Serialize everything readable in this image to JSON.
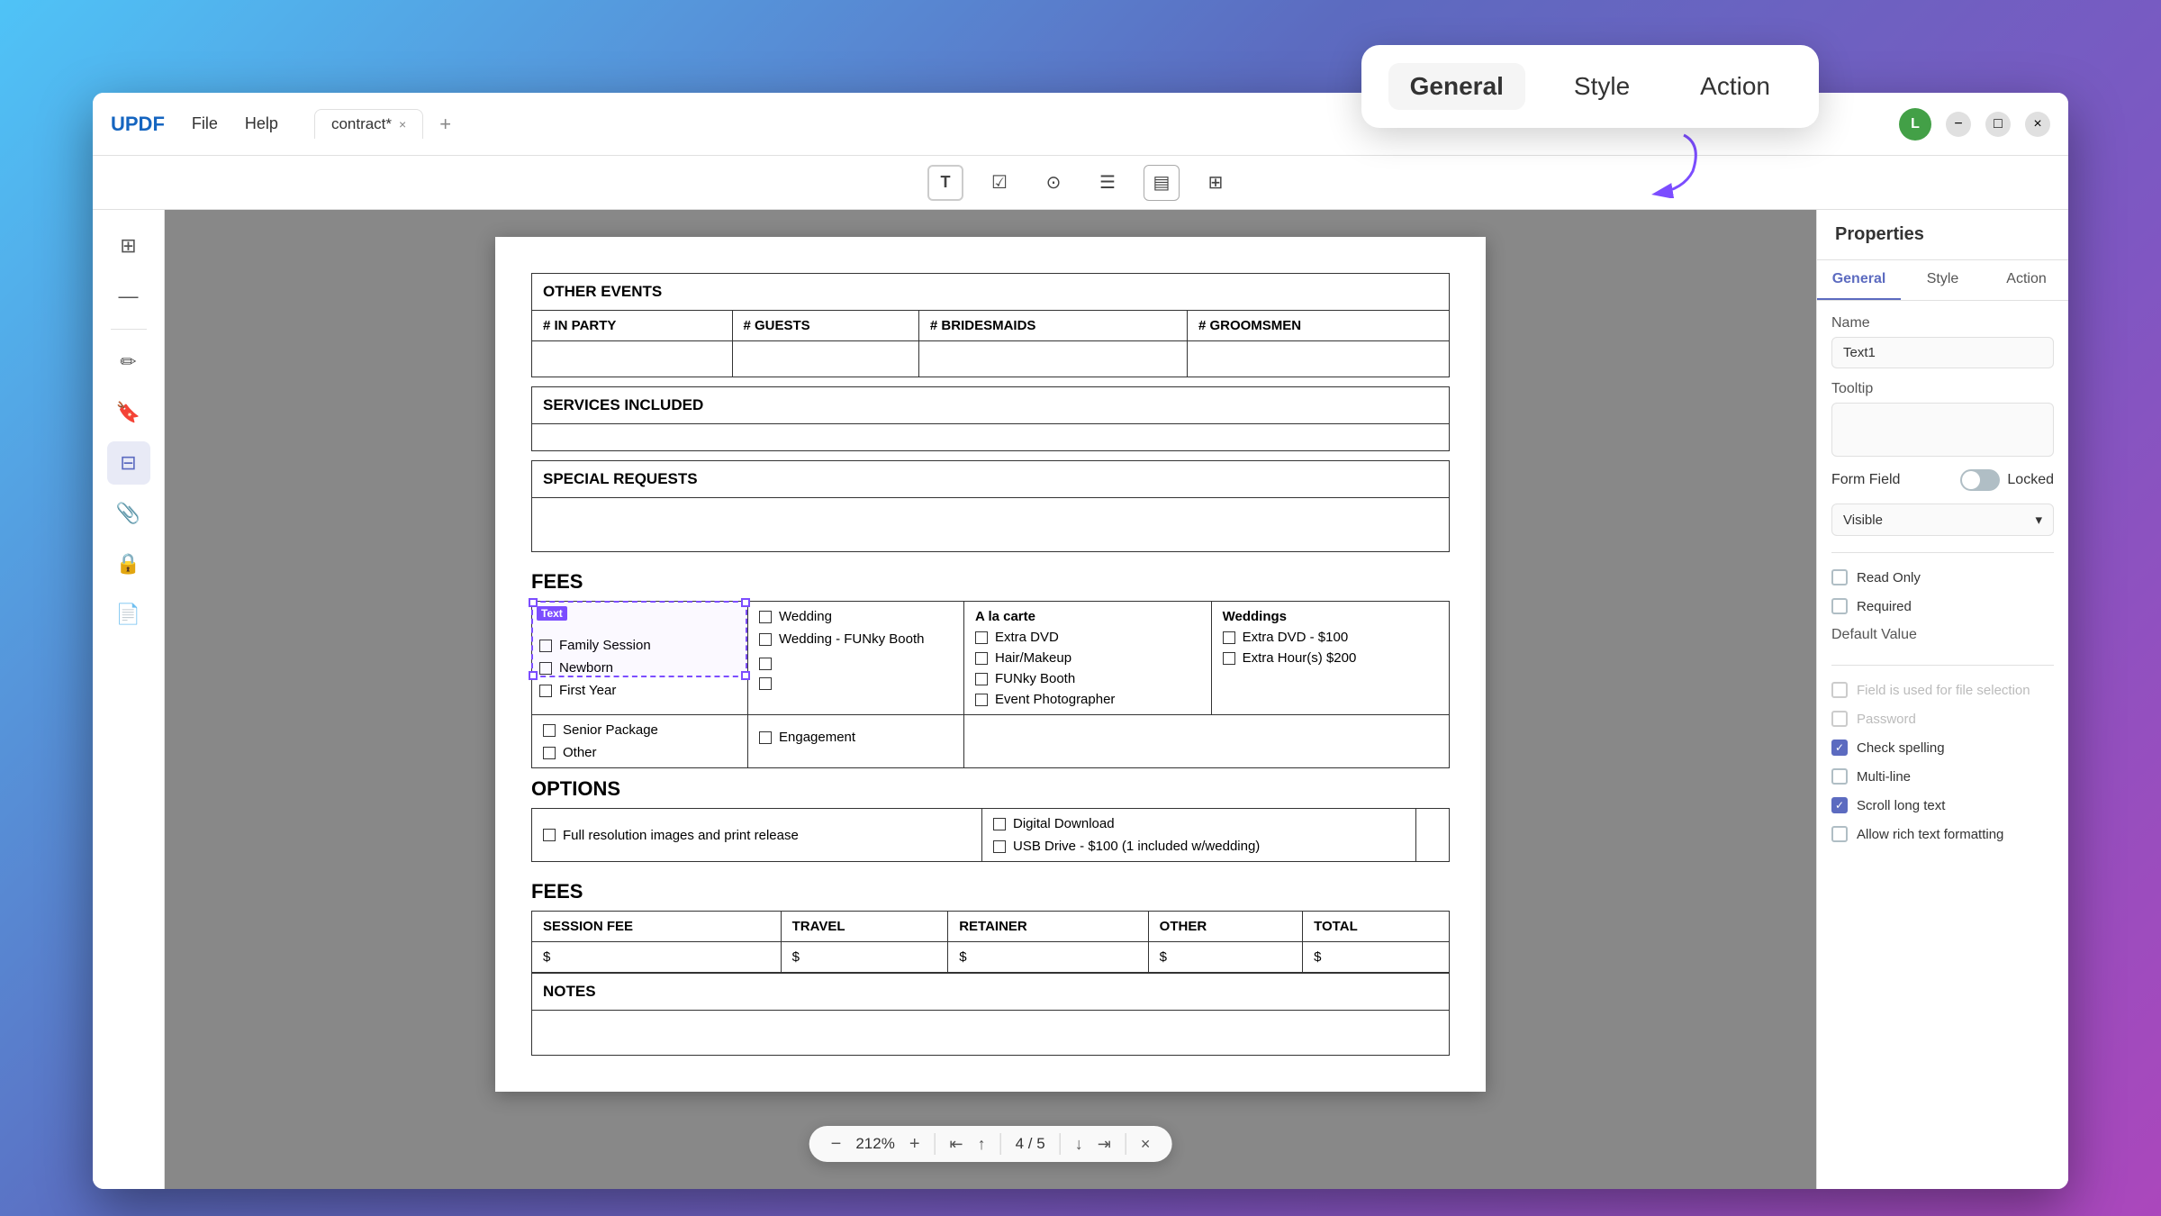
{
  "app": {
    "brand": "UPDF",
    "menu": [
      "File",
      "Help"
    ],
    "tab_label": "contract*",
    "tab_close": "×",
    "tab_add": "+",
    "window_controls": [
      "−",
      "□",
      "×"
    ],
    "user_initial": "L"
  },
  "toolbar": {
    "tools": [
      {
        "name": "text-field-tool",
        "icon": "T",
        "label": "Text Field"
      },
      {
        "name": "checkbox-tool",
        "icon": "☑",
        "label": "Checkbox"
      },
      {
        "name": "radio-tool",
        "icon": "⊙",
        "label": "Radio"
      },
      {
        "name": "list-tool",
        "icon": "☰",
        "label": "List"
      },
      {
        "name": "dropdown-tool",
        "icon": "▤",
        "label": "Dropdown"
      },
      {
        "name": "button-tool",
        "icon": "⊞",
        "label": "Button"
      }
    ]
  },
  "sidebar": {
    "icons": [
      {
        "name": "thumbnail-icon",
        "icon": "⊞"
      },
      {
        "name": "zoom-out-icon",
        "icon": "−"
      },
      {
        "name": "annotate-icon",
        "icon": "✏"
      },
      {
        "name": "bookmark-icon",
        "icon": "🔖"
      },
      {
        "name": "form-icon",
        "icon": "⊟"
      },
      {
        "name": "attachment-icon",
        "icon": "📎"
      },
      {
        "name": "security-icon",
        "icon": "🔒"
      },
      {
        "name": "page-icon",
        "icon": "📄"
      }
    ]
  },
  "document": {
    "sections": {
      "other_events": "OTHER EVENTS",
      "in_party": "# IN PARTY",
      "guests": "# GUESTS",
      "bridesmaids": "# BRIDESMAIDS",
      "groomsmen": "# GROOMSMEN",
      "services_included": "SERVICES INCLUDED",
      "special_requests": "SPECIAL REQUESTS",
      "fees_header": "FEES",
      "options_header": "OPTIONS",
      "fees_section": "FEES",
      "session_fee": "SESSION FEE",
      "session_fee_val": "$",
      "travel": "TRAVEL",
      "travel_val": "$",
      "retainer": "RETAINER",
      "retainer_val": "$",
      "other": "OTHER",
      "other_val": "$",
      "total": "TOTAL",
      "total_val": "$",
      "notes": "NOTES"
    },
    "checkboxes_left": [
      "Family Session",
      "Newborn",
      "First Year",
      "Senior Package",
      "Other"
    ],
    "checkboxes_mid": [
      "Wedding",
      "Wedding - FUNky Booth",
      "",
      "",
      "Engagement"
    ],
    "checkboxes_right_label": "A la carte",
    "checkboxes_right": [
      "Extra DVD",
      "Hair/Makeup",
      "FUNky Booth",
      "Event Photographer"
    ],
    "checkboxes_weddings_label": "Weddings",
    "checkboxes_weddings": [
      "Extra DVD - $100",
      "Extra Hour(s) $200"
    ],
    "options_left": [
      "Full resolution images and print release"
    ],
    "options_right": [
      "Digital Download",
      "USB Drive - $100 (1 included w/wedding)"
    ],
    "text_field_label": "Text"
  },
  "floating_popup": {
    "tabs": [
      "General",
      "Style",
      "Action"
    ],
    "active_tab": "General"
  },
  "properties_panel": {
    "header": "Properties",
    "tabs": [
      "General",
      "Style",
      "Action"
    ],
    "active_tab": "General",
    "name_label": "Name",
    "name_value": "Text1",
    "tooltip_label": "Tooltip",
    "tooltip_value": "",
    "form_field_label": "Form Field",
    "locked_label": "Locked",
    "toggle_locked": false,
    "visible_label": "Visible",
    "visible_value": "Visible",
    "read_only_label": "Read Only",
    "read_only_checked": false,
    "required_label": "Required",
    "required_checked": false,
    "default_value_label": "Default Value",
    "file_selection_label": "Field is used for file selection",
    "file_selection_checked": false,
    "password_label": "Password",
    "password_checked": false,
    "check_spelling_label": "Check spelling",
    "check_spelling_checked": true,
    "multi_line_label": "Multi-line",
    "multi_line_checked": false,
    "scroll_long_label": "Scroll long text",
    "scroll_long_checked": true,
    "allow_rich_label": "Allow rich text formatting",
    "allow_rich_checked": false
  },
  "bottom_toolbar": {
    "zoom_out": "−",
    "zoom_value": "212%",
    "zoom_in": "+",
    "nav_first": "⇤",
    "nav_prev": "↑",
    "page_current": "4",
    "page_sep": "/",
    "page_total": "5",
    "nav_next": "↓",
    "nav_last": "⇥",
    "close": "×"
  }
}
